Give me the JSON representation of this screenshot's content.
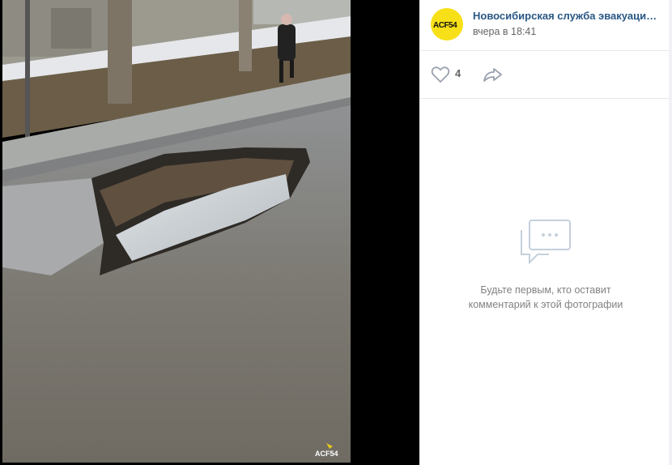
{
  "photo": {
    "watermark": "ACF54",
    "alt": "Провал асфальта на дороге"
  },
  "post": {
    "avatar_text": "ACF54",
    "author": "Новосибирская служба эвакуации...",
    "time": "вчера в 18:41"
  },
  "actions": {
    "like_count": "4"
  },
  "comments": {
    "empty_line1": "Будьте первым, кто оставит",
    "empty_line2": "комментарий к этой фотографии"
  },
  "colors": {
    "link": "#2a5885",
    "muted": "#828282",
    "avatar_bg": "#f7e018"
  }
}
